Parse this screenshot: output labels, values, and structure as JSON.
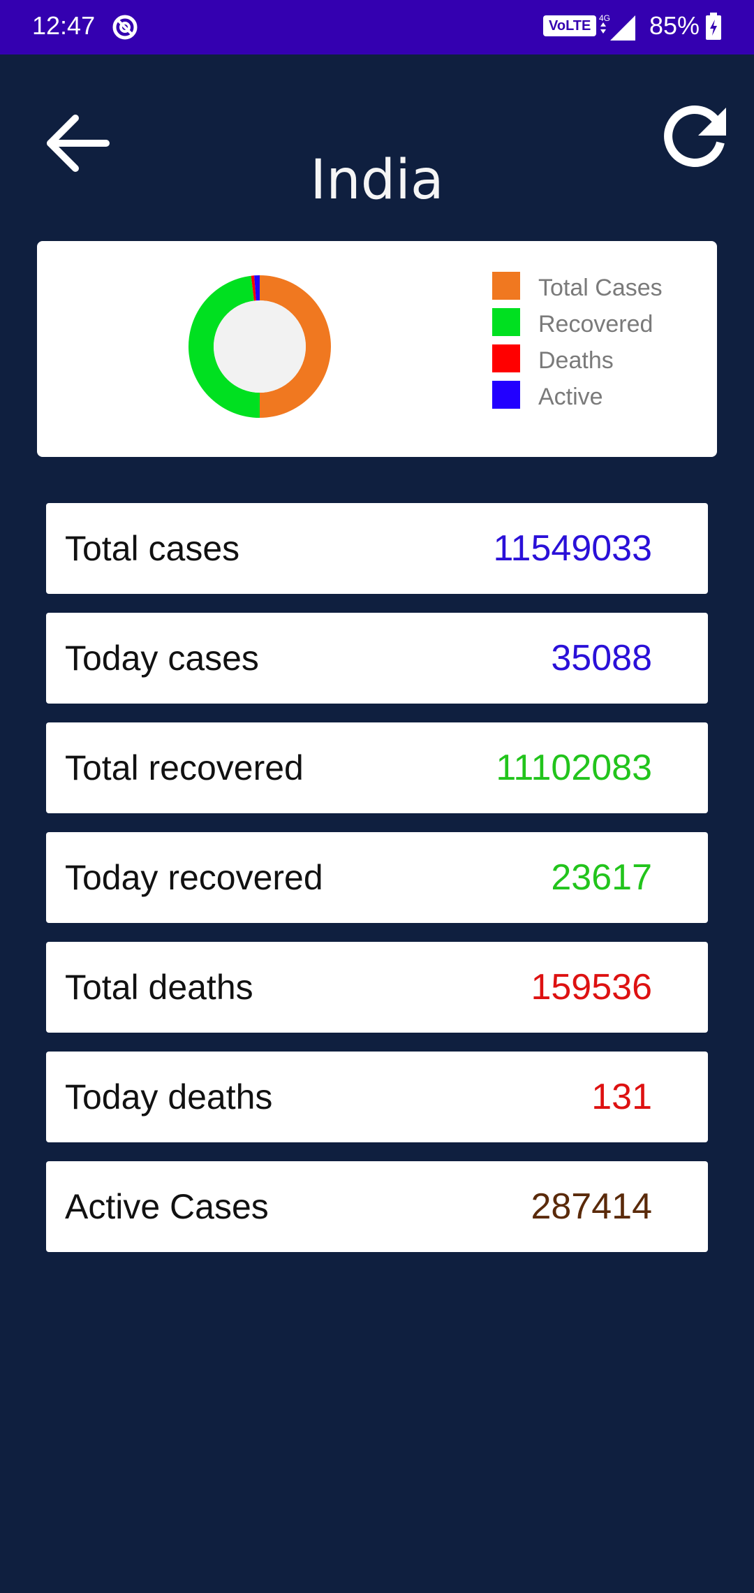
{
  "status_bar": {
    "time": "12:47",
    "volte": "VoLTE",
    "network": "4G",
    "battery": "85%",
    "icons": [
      "dnd-icon",
      "signal-icon",
      "battery-icon"
    ]
  },
  "header": {
    "title": "India",
    "back_icon": "arrow-left-icon",
    "refresh_icon": "refresh-icon"
  },
  "colors": {
    "background": "#0f1f3f",
    "status_bar": "#3400b0",
    "total_cases": "#f07820",
    "recovered": "#00e020",
    "deaths": "#ff0000",
    "active": "#2200ff",
    "blue_value": "#2a10d8",
    "green_value": "#22c41c",
    "red_value": "#dd1111",
    "brown_value": "#5a2a0a"
  },
  "chart_data": {
    "type": "pie",
    "labels": [
      "Total Cases",
      "Recovered",
      "Deaths",
      "Active"
    ],
    "values": [
      11549033,
      11102083,
      159536,
      287414
    ],
    "colors": [
      "#f07820",
      "#00e020",
      "#ff0000",
      "#2200ff"
    ],
    "legend_position": "right",
    "style": "donut"
  },
  "stats": [
    {
      "label": "Total cases",
      "value": "11549033",
      "color": "#2a10d8"
    },
    {
      "label": "Today cases",
      "value": "35088",
      "color": "#2a10d8"
    },
    {
      "label": "Total recovered",
      "value": "11102083",
      "color": "#22c41c"
    },
    {
      "label": "Today recovered",
      "value": "23617",
      "color": "#22c41c"
    },
    {
      "label": "Total deaths",
      "value": "159536",
      "color": "#dd1111"
    },
    {
      "label": "Today deaths",
      "value": "131",
      "color": "#dd1111"
    },
    {
      "label": "Active Cases",
      "value": "287414",
      "color": "#5a2a0a"
    }
  ]
}
